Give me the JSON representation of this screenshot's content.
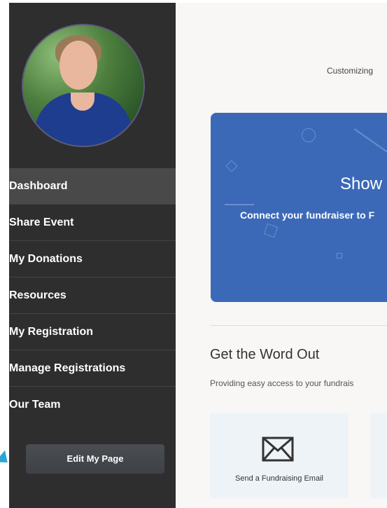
{
  "sidebar": {
    "nav": [
      {
        "label": "Dashboard",
        "active": true
      },
      {
        "label": "Share Event"
      },
      {
        "label": "My Donations"
      },
      {
        "label": "Resources"
      },
      {
        "label": "My Registration"
      },
      {
        "label": "Manage Registrations"
      },
      {
        "label": "Our Team"
      }
    ],
    "edit_button": "Edit My Page"
  },
  "main": {
    "customizing_text": "Customizing",
    "banner": {
      "title": "Show",
      "subtitle": "Connect your fundraiser to F"
    },
    "get_word_out": {
      "title": "Get the Word Out",
      "subtitle": "Providing easy access to your fundrais",
      "cards": [
        {
          "label": "Send a Fundraising Email",
          "icon": "envelope-icon"
        }
      ]
    }
  },
  "colors": {
    "sidebar_bg": "#2f2e2e",
    "banner_bg": "#3b69b8",
    "accent_arrow": "#2aa6d6"
  }
}
